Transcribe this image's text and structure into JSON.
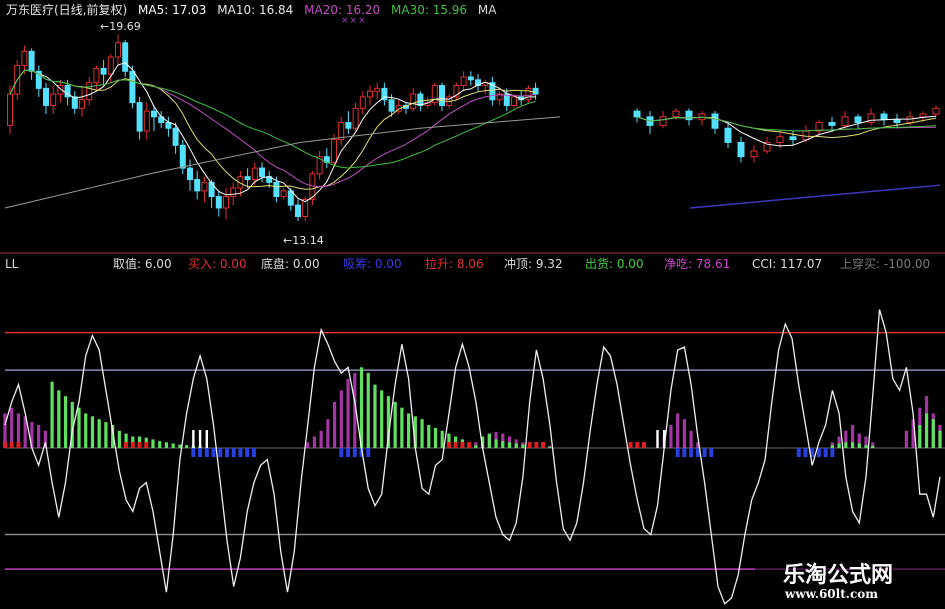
{
  "chart_data": [
    {
      "type": "candlestick",
      "title": "万东医疗(日线,前复权)",
      "indicators": [
        {
          "name": "MA5",
          "label": "MA5: 17.03",
          "value": 17.03,
          "color": "#ffffff"
        },
        {
          "name": "MA10",
          "label": "MA10: 16.84",
          "value": 16.84,
          "color": "#e0e070"
        },
        {
          "name": "MA20",
          "label": "MA20: 16.20",
          "value": 16.2,
          "color": "#c050c0"
        },
        {
          "name": "MA30",
          "label": "MA30: 15.96",
          "value": 15.96,
          "color": "#40c040"
        },
        {
          "name": "MA",
          "label": "MA",
          "value": null,
          "color": "#c0c0c0"
        }
      ],
      "annotations": [
        {
          "label": "19.69",
          "value": 19.69
        },
        {
          "label": "13.14",
          "value": 13.14
        }
      ],
      "marker": "×××",
      "ylim": [
        12.3,
        20.2
      ],
      "candles_left": [
        [
          16.5,
          17.6,
          16.2,
          17.9
        ],
        [
          17.6,
          18.6,
          17.4,
          18.8
        ],
        [
          18.6,
          19.1,
          18.3,
          19.3
        ],
        [
          19.1,
          18.4,
          18.1,
          19.2
        ],
        [
          18.4,
          17.8,
          17.5,
          18.6
        ],
        [
          17.8,
          17.2,
          16.9,
          18.0
        ],
        [
          17.2,
          17.6,
          16.9,
          17.9
        ],
        [
          17.6,
          17.9,
          17.3,
          18.1
        ],
        [
          17.9,
          17.5,
          17.2,
          18.1
        ],
        [
          17.5,
          17.1,
          16.9,
          17.7
        ],
        [
          17.1,
          17.4,
          16.8,
          17.8
        ],
        [
          17.4,
          18.0,
          17.2,
          18.2
        ],
        [
          18.0,
          18.5,
          17.7,
          18.6
        ],
        [
          18.5,
          18.3,
          17.9,
          18.8
        ],
        [
          18.3,
          18.9,
          18.0,
          19.0
        ],
        [
          18.9,
          19.4,
          18.6,
          19.69
        ],
        [
          19.4,
          18.4,
          18.2,
          19.5
        ],
        [
          18.4,
          17.3,
          17.1,
          18.6
        ],
        [
          17.3,
          16.3,
          16.0,
          17.5
        ],
        [
          16.3,
          17.0,
          16.0,
          17.3
        ],
        [
          17.0,
          16.8,
          16.3,
          17.2
        ],
        [
          16.8,
          16.6,
          16.4,
          17.0
        ],
        [
          16.6,
          16.4,
          16.1,
          16.8
        ],
        [
          16.4,
          15.8,
          15.5,
          16.6
        ],
        [
          15.8,
          15.0,
          14.8,
          16.0
        ],
        [
          15.0,
          14.6,
          14.2,
          15.3
        ],
        [
          14.6,
          14.2,
          13.9,
          14.9
        ],
        [
          14.2,
          14.5,
          13.8,
          14.7
        ],
        [
          14.5,
          14.0,
          13.6,
          14.6
        ],
        [
          14.0,
          13.6,
          13.3,
          14.2
        ],
        [
          13.6,
          14.0,
          13.2,
          14.3
        ],
        [
          14.0,
          14.3,
          13.7,
          14.5
        ],
        [
          14.3,
          14.7,
          14.0,
          14.9
        ],
        [
          14.7,
          14.6,
          14.3,
          15.0
        ],
        [
          14.6,
          15.0,
          14.4,
          15.2
        ],
        [
          15.0,
          14.7,
          14.5,
          15.2
        ],
        [
          14.7,
          14.5,
          14.3,
          14.9
        ],
        [
          14.5,
          14.0,
          13.8,
          14.7
        ],
        [
          14.0,
          14.2,
          13.9,
          14.3
        ],
        [
          14.2,
          13.7,
          13.5,
          14.3
        ],
        [
          13.7,
          13.3,
          13.14,
          13.9
        ],
        [
          13.3,
          13.9,
          13.14,
          14.0
        ],
        [
          13.9,
          14.8,
          13.7,
          14.9
        ],
        [
          14.8,
          15.4,
          14.6,
          15.6
        ],
        [
          15.4,
          15.2,
          15.0,
          15.7
        ],
        [
          15.2,
          16.0,
          15.1,
          16.2
        ],
        [
          16.0,
          16.6,
          15.8,
          16.8
        ],
        [
          16.6,
          16.4,
          16.2,
          17.0
        ],
        [
          16.4,
          17.1,
          16.3,
          17.3
        ],
        [
          17.1,
          17.5,
          16.9,
          17.7
        ],
        [
          17.5,
          17.7,
          17.2,
          17.9
        ],
        [
          17.7,
          17.8,
          17.4,
          18.0
        ],
        [
          17.8,
          17.4,
          17.2,
          18.0
        ],
        [
          17.4,
          17.0,
          16.8,
          17.6
        ],
        [
          17.0,
          17.2,
          16.9,
          17.4
        ],
        [
          17.2,
          17.1,
          16.9,
          17.3
        ],
        [
          17.1,
          17.6,
          17.0,
          17.8
        ],
        [
          17.6,
          17.2,
          17.0,
          17.7
        ],
        [
          17.2,
          17.3,
          17.1,
          17.5
        ],
        [
          17.3,
          17.9,
          17.2,
          18.0
        ],
        [
          17.9,
          17.2,
          17.0,
          18.0
        ],
        [
          17.2,
          17.5,
          17.1,
          17.6
        ],
        [
          17.5,
          17.9,
          17.4,
          18.0
        ],
        [
          17.9,
          18.2,
          17.7,
          18.4
        ],
        [
          18.2,
          18.1,
          17.9,
          18.4
        ],
        [
          18.1,
          17.9,
          17.7,
          18.3
        ],
        [
          17.9,
          18.0,
          17.6,
          18.1
        ],
        [
          18.0,
          17.4,
          17.2,
          18.2
        ],
        [
          17.4,
          17.6,
          17.2,
          17.7
        ],
        [
          17.6,
          17.2,
          17.0,
          17.8
        ],
        [
          17.2,
          17.5,
          17.1,
          17.6
        ],
        [
          17.5,
          17.4,
          17.2,
          17.7
        ],
        [
          17.4,
          17.8,
          17.3,
          17.9
        ],
        [
          17.8,
          17.6,
          17.4,
          18.0
        ]
      ],
      "candles_right": [
        [
          17.0,
          16.8,
          16.6,
          17.1
        ],
        [
          16.8,
          16.5,
          16.2,
          17.0
        ],
        [
          16.5,
          16.8,
          16.4,
          17.0
        ],
        [
          16.8,
          17.0,
          16.7,
          17.1
        ],
        [
          17.0,
          16.7,
          16.5,
          17.1
        ],
        [
          16.7,
          16.9,
          16.5,
          17.0
        ],
        [
          16.9,
          16.4,
          16.2,
          17.0
        ],
        [
          16.4,
          15.9,
          15.7,
          16.6
        ],
        [
          15.9,
          15.4,
          15.2,
          16.1
        ],
        [
          15.4,
          15.6,
          15.2,
          15.8
        ],
        [
          15.6,
          15.9,
          15.5,
          16.1
        ],
        [
          15.9,
          16.1,
          15.7,
          16.3
        ],
        [
          16.1,
          16.0,
          15.8,
          16.3
        ],
        [
          16.0,
          16.3,
          15.9,
          16.5
        ],
        [
          16.3,
          16.6,
          16.1,
          16.7
        ],
        [
          16.6,
          16.5,
          16.3,
          16.8
        ],
        [
          16.5,
          16.8,
          16.4,
          17.0
        ],
        [
          16.8,
          16.6,
          16.4,
          16.9
        ],
        [
          16.6,
          16.9,
          16.5,
          17.1
        ],
        [
          16.9,
          16.7,
          16.5,
          17.0
        ],
        [
          16.7,
          16.6,
          16.4,
          16.9
        ],
        [
          16.6,
          16.8,
          16.5,
          17.0
        ],
        [
          16.8,
          16.9,
          16.6,
          17.0
        ],
        [
          16.9,
          17.1,
          16.8,
          17.2
        ]
      ]
    },
    {
      "type": "indicator",
      "name": "LL",
      "readouts": [
        {
          "label": "取值: 6.00",
          "color": "#dcdcdc"
        },
        {
          "label": "买入: 0.00",
          "color": "#e03030"
        },
        {
          "label": "底盘: 0.00",
          "color": "#dcdcdc"
        },
        {
          "label": "吸筹: 0.00",
          "color": "#3a3ae0"
        },
        {
          "label": "拉升: 8.06",
          "color": "#e03030"
        },
        {
          "label": "冲顶: 9.32",
          "color": "#dcdcdc"
        },
        {
          "label": "出货: 0.00",
          "color": "#40d040"
        },
        {
          "label": "净吃: 78.61",
          "color": "#d040d0"
        },
        {
          "label": "CCI: 117.07",
          "color": "#dcdcdc"
        },
        {
          "label": "上穿买: -100.00",
          "color": "#7a7a7a"
        }
      ],
      "ylim": [
        -260,
        300
      ],
      "levels": [
        {
          "value": 200,
          "color": "#e03030"
        },
        {
          "value": 135,
          "color": "#8a8ab8"
        },
        {
          "value": -150,
          "color": "#8a8a8a"
        },
        {
          "value": -210,
          "color": "#c040c0"
        }
      ],
      "cci": [
        40,
        80,
        110,
        60,
        0,
        -30,
        10,
        -60,
        -120,
        -60,
        30,
        80,
        160,
        195,
        170,
        100,
        30,
        -40,
        -90,
        -110,
        -70,
        -60,
        -110,
        -180,
        -250,
        -150,
        -20,
        60,
        120,
        160,
        120,
        40,
        -60,
        -160,
        -240,
        -190,
        -110,
        -60,
        -30,
        -20,
        -80,
        -180,
        -250,
        -180,
        -60,
        40,
        140,
        205,
        180,
        150,
        130,
        140,
        80,
        0,
        -70,
        -100,
        -80,
        20,
        110,
        180,
        120,
        0,
        -70,
        -80,
        -30,
        -20,
        60,
        140,
        180,
        140,
        80,
        0,
        -60,
        -120,
        -150,
        -160,
        -130,
        -50,
        80,
        170,
        120,
        40,
        -60,
        -140,
        -160,
        -130,
        -60,
        30,
        110,
        175,
        160,
        110,
        40,
        -30,
        -90,
        -140,
        -150,
        -100,
        0,
        100,
        170,
        175,
        110,
        20,
        -60,
        -150,
        -240,
        -270,
        -260,
        -220,
        -150,
        -90,
        -60,
        -20,
        80,
        170,
        215,
        190,
        110,
        40,
        -30,
        10,
        40,
        100,
        60,
        -50,
        -110,
        -130,
        -50,
        90,
        240,
        200,
        120,
        100,
        140,
        60,
        -80,
        -80,
        -120,
        -50
      ],
      "bars": [
        {
          "from": 0,
          "to": 7,
          "colors": [
            "#c040c0"
          ],
          "values": [
            60,
            70,
            60,
            55,
            45,
            40,
            30,
            20
          ]
        },
        {
          "from": 7,
          "to": 20,
          "colors": [
            "#60e060"
          ],
          "values": [
            115,
            100,
            90,
            80,
            70,
            60,
            55,
            50,
            45,
            40,
            30,
            25,
            20
          ]
        },
        {
          "from": 20,
          "to": 30,
          "colors": [
            "#60e060"
          ],
          "values": [
            20,
            18,
            15,
            12,
            10,
            8,
            6,
            5,
            4,
            3
          ]
        },
        {
          "from": 45,
          "to": 53,
          "colors": [
            "#c040c0"
          ],
          "values": [
            10,
            20,
            30,
            50,
            80,
            100,
            120,
            130
          ]
        },
        {
          "from": 53,
          "to": 70,
          "colors": [
            "#60e060"
          ],
          "values": [
            140,
            130,
            110,
            100,
            90,
            80,
            70,
            60,
            55,
            50,
            40,
            35,
            30,
            25,
            20,
            15,
            10
          ]
        },
        {
          "from": 70,
          "to": 82,
          "colors": [
            "#c040c0"
          ],
          "values": [
            10,
            20,
            25,
            28,
            25,
            20,
            15,
            10,
            8,
            6,
            5,
            4
          ]
        },
        {
          "from": 70,
          "to": 82,
          "colors": [
            "#60e060"
          ],
          "values": [
            5,
            20,
            25,
            15,
            12,
            10,
            8,
            6,
            5,
            4,
            3,
            2
          ]
        },
        {
          "from": 98,
          "to": 104,
          "colors": [
            "#c040c0"
          ],
          "values": [
            20,
            40,
            60,
            50,
            30,
            10
          ]
        },
        {
          "from": 123,
          "to": 130,
          "colors": [
            "#c040c0"
          ],
          "values": [
            10,
            20,
            30,
            40,
            25,
            20,
            10
          ]
        },
        {
          "from": 123,
          "to": 130,
          "colors": [
            "#60e060"
          ],
          "values": [
            5,
            8,
            10,
            10,
            8,
            5,
            4
          ]
        },
        {
          "from": 134,
          "to": 142,
          "colors": [
            "#c040c0"
          ],
          "values": [
            30,
            50,
            70,
            90,
            60,
            40,
            30,
            60
          ]
        },
        {
          "from": 136,
          "to": 140,
          "colors": [
            "#60e060"
          ],
          "values": [
            40,
            60,
            50,
            30
          ]
        }
      ],
      "blue_blocks": [
        [
          28,
          38
        ],
        [
          50,
          55
        ],
        [
          100,
          106
        ],
        [
          118,
          124
        ]
      ],
      "white_blocks": [
        [
          28,
          31
        ],
        [
          97,
          99
        ]
      ],
      "red_blocks": [
        [
          0,
          3
        ],
        [
          18,
          22
        ],
        [
          66,
          70
        ],
        [
          78,
          81
        ],
        [
          93,
          96
        ]
      ]
    }
  ],
  "watermark": {
    "title": "乐淘公式网",
    "url": "www.60lt.com"
  }
}
